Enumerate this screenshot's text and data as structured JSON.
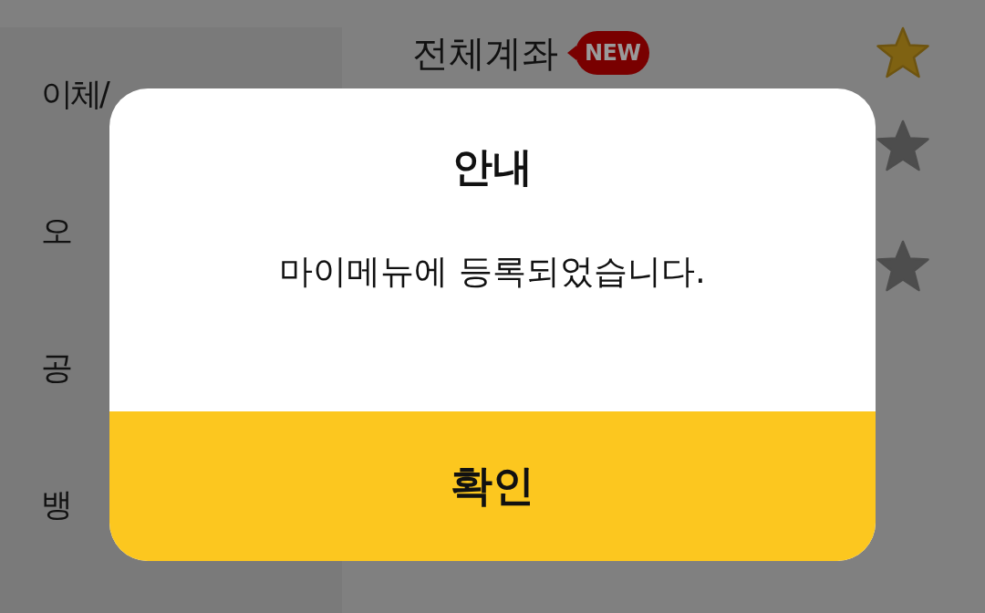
{
  "sidebar": {
    "items": [
      {
        "label": "이체/"
      },
      {
        "label": "오"
      },
      {
        "label": "공"
      },
      {
        "label": "뱅"
      }
    ]
  },
  "menu_rows": [
    {
      "label": "전체계좌",
      "badge": "NEW",
      "favorite": true
    },
    {
      "favorite": false
    },
    {
      "favorite": false
    }
  ],
  "dialog": {
    "title": "안내",
    "message": "마이메뉴에 등록되었습니다.",
    "button": "확인"
  }
}
